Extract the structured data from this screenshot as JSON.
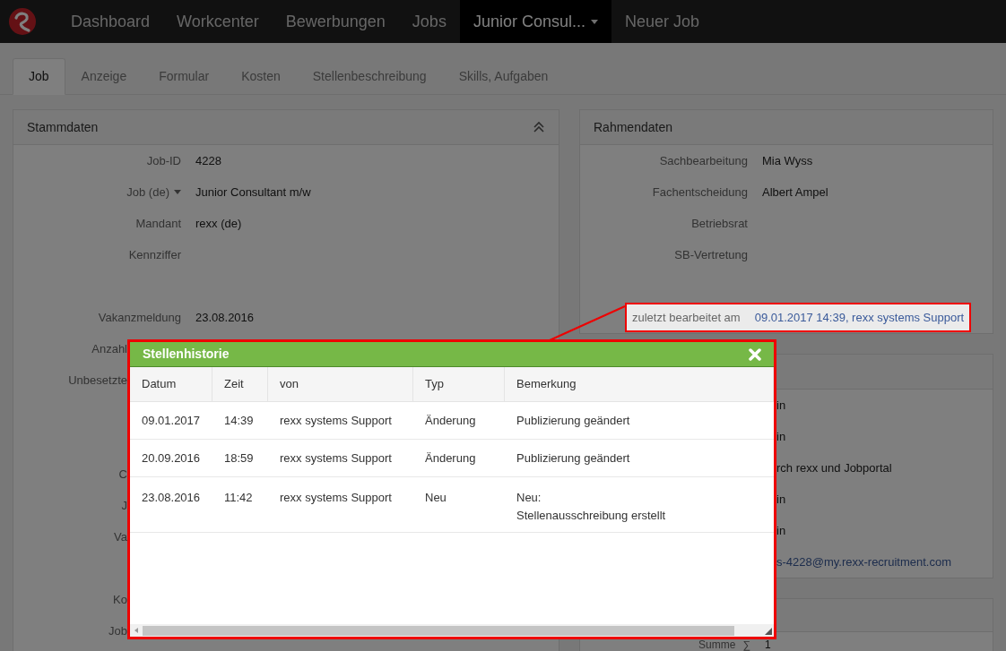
{
  "navbar": {
    "items": [
      {
        "label": "Dashboard",
        "selected": false,
        "kind": "link"
      },
      {
        "label": "Workcenter",
        "selected": false,
        "kind": "link"
      },
      {
        "label": "Bewerbungen",
        "selected": false,
        "kind": "link"
      },
      {
        "label": "Jobs",
        "selected": false,
        "kind": "link"
      },
      {
        "label": "Junior Consul...",
        "selected": true,
        "kind": "dropdown"
      },
      {
        "label": "Neuer Job",
        "selected": false,
        "kind": "link"
      }
    ]
  },
  "tabs": [
    {
      "label": "Job",
      "selected": true
    },
    {
      "label": "Anzeige",
      "selected": false
    },
    {
      "label": "Formular",
      "selected": false
    },
    {
      "label": "Kosten",
      "selected": false
    },
    {
      "label": "Stellenbeschreibung",
      "selected": false
    },
    {
      "label": "Skills, Aufgaben",
      "selected": false
    }
  ],
  "stammdaten": {
    "title": "Stammdaten",
    "fields": [
      {
        "kind": "plain",
        "label": "Job-ID",
        "value": "4228"
      },
      {
        "kind": "dropdown",
        "label": "Job (de)",
        "value": "Junior Consultant m/w"
      },
      {
        "kind": "plain",
        "label": "Mandant",
        "value": "rexx (de)"
      },
      {
        "kind": "plain",
        "label": "Kennziffer"
      },
      {
        "kind": "spacer"
      },
      {
        "kind": "plain",
        "label": "Vakanzmeldung",
        "value": "23.08.2016"
      },
      {
        "kind": "covered",
        "label": "Anzahl"
      },
      {
        "kind": "covered",
        "label": "Unbesetzte"
      },
      {
        "kind": "spacer"
      },
      {
        "kind": "spacer"
      },
      {
        "kind": "covered",
        "label": "C"
      },
      {
        "kind": "covered",
        "label": "J"
      },
      {
        "kind": "covered",
        "label": "Va"
      },
      {
        "kind": "spacer"
      },
      {
        "kind": "covered",
        "label": "Ko"
      },
      {
        "kind": "covered",
        "label": "Job"
      }
    ]
  },
  "rahmendaten": {
    "title": "Rahmendaten",
    "fields": [
      {
        "kind": "plain",
        "label": "Sachbearbeitung",
        "value": "Mia Wyss"
      },
      {
        "kind": "plain",
        "label": "Fachentscheidung",
        "value": "Albert Ampel"
      },
      {
        "kind": "plain",
        "label": "Betriebsrat"
      },
      {
        "kind": "plain",
        "label": "SB-Vertretung"
      },
      {
        "kind": "spacer"
      },
      {
        "kind": "highlighted",
        "label": "zuletzt bearbeitet am",
        "value": "09.01.2017 14:39, rexx systems Support"
      }
    ]
  },
  "section_2": {
    "values": [
      {
        "kind": "plain",
        "value": "in"
      },
      {
        "kind": "plain",
        "value": "in"
      },
      {
        "kind": "plain",
        "value": "rch rexx und Jobportal"
      },
      {
        "kind": "plain",
        "value": "in"
      },
      {
        "kind": "plain",
        "value": "in"
      },
      {
        "kind": "link",
        "value": "s-4228@my.rexx-recruitment.com"
      }
    ]
  },
  "section_3": {
    "rows": [
      {
        "label": "Summe",
        "symbol": "∑",
        "value": "1"
      }
    ]
  },
  "dialog": {
    "title": "Stellenhistorie",
    "columns": [
      "Datum",
      "Zeit",
      "von",
      "Typ",
      "Bemerkung"
    ],
    "rows": [
      {
        "cells": [
          "09.01.2017",
          "14:39",
          "rexx systems Support",
          "Änderung",
          "Publizierung geändert"
        ]
      },
      {
        "cells": [
          "20.09.2016",
          "18:59",
          "rexx systems Support",
          "Änderung",
          "Publizierung geändert"
        ]
      },
      {
        "cells": [
          "23.08.2016",
          "11:42",
          "rexx systems Support",
          "Neu",
          "Neu:\nStellenausschreibung erstellt"
        ]
      }
    ]
  }
}
